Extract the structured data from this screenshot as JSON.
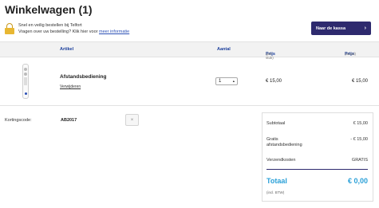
{
  "page": {
    "title": "Winkelwagen (1)"
  },
  "secure": {
    "line1": "Snel en veilig bestellen bij Telfort",
    "line2_prefix": "Vragen over uw bestelling? Klik hier voor ",
    "line2_link": "meer informatie"
  },
  "checkout": {
    "label": "Naar de kassa",
    "arrow": "›"
  },
  "table": {
    "headers": {
      "article": "Artikel",
      "quantity": "Aantal",
      "price": "Prijs",
      "price_sub": "(per stuk)",
      "total": "Prijs",
      "total_sub": "(totaal)"
    }
  },
  "item": {
    "name": "Afstandsbediening",
    "remove": "Verwijderen",
    "quantity": "1",
    "unit_price": "€ 15,00",
    "line_total": "€ 15,00"
  },
  "coupon": {
    "label": "Kortingscode:",
    "code": "AB2017",
    "remove": "×"
  },
  "summary": {
    "subtotal_label": "Subtotaal",
    "subtotal_value": "€ 15,00",
    "discount_label_1": "Gratis",
    "discount_label_2": "afstandsbediening",
    "discount_value": "- € 15,00",
    "shipping_label": "Verzendkosten",
    "shipping_value": "GRATIS",
    "total_label": "Totaal",
    "total_value": "€ 0,00",
    "vat_note": "(incl. BTW)"
  },
  "colors": {
    "brand": "#2e2a6e",
    "accent": "#2aa0d8",
    "link": "#2a4fb5",
    "header_text": "#1c3f9c"
  }
}
